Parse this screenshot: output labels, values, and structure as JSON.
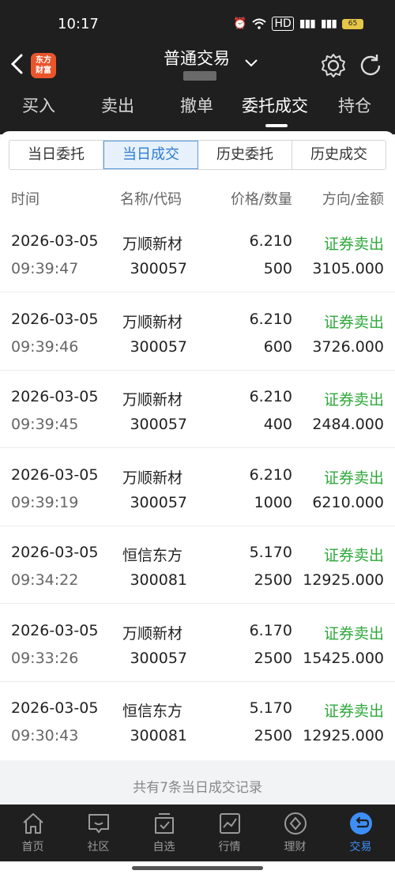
{
  "status_bar": {
    "time": "10:17",
    "battery": "65",
    "network": "4G"
  },
  "header": {
    "logo_text_line1": "东方",
    "logo_text_line2": "财富",
    "title": "普通交易"
  },
  "main_tabs": [
    {
      "label": "买入"
    },
    {
      "label": "卖出"
    },
    {
      "label": "撤单"
    },
    {
      "label": "委托成交",
      "active": true
    },
    {
      "label": "持仓"
    }
  ],
  "sub_tabs": [
    {
      "label": "当日委托"
    },
    {
      "label": "当日成交",
      "active": true
    },
    {
      "label": "历史委托"
    },
    {
      "label": "历史成交"
    }
  ],
  "columns": {
    "time": "时间",
    "name_code": "名称/代码",
    "price_qty": "价格/数量",
    "dir_amount": "方向/金额"
  },
  "rows": [
    {
      "date": "2026-03-05",
      "time": "09:39:47",
      "name": "万顺新材",
      "code": "300057",
      "price": "6.210",
      "qty": "500",
      "direction": "证券卖出",
      "amount": "3105.000"
    },
    {
      "date": "2026-03-05",
      "time": "09:39:46",
      "name": "万顺新材",
      "code": "300057",
      "price": "6.210",
      "qty": "600",
      "direction": "证券卖出",
      "amount": "3726.000"
    },
    {
      "date": "2026-03-05",
      "time": "09:39:45",
      "name": "万顺新材",
      "code": "300057",
      "price": "6.210",
      "qty": "400",
      "direction": "证券卖出",
      "amount": "2484.000"
    },
    {
      "date": "2026-03-05",
      "time": "09:39:19",
      "name": "万顺新材",
      "code": "300057",
      "price": "6.210",
      "qty": "1000",
      "direction": "证券卖出",
      "amount": "6210.000"
    },
    {
      "date": "2026-03-05",
      "time": "09:34:22",
      "name": "恒信东方",
      "code": "300081",
      "price": "5.170",
      "qty": "2500",
      "direction": "证券卖出",
      "amount": "12925.000"
    },
    {
      "date": "2026-03-05",
      "time": "09:33:26",
      "name": "万顺新材",
      "code": "300057",
      "price": "6.170",
      "qty": "2500",
      "direction": "证券卖出",
      "amount": "15425.000"
    },
    {
      "date": "2026-03-05",
      "time": "09:30:43",
      "name": "恒信东方",
      "code": "300081",
      "price": "5.170",
      "qty": "2500",
      "direction": "证券卖出",
      "amount": "12925.000"
    }
  ],
  "footer_note": "共有7条当日成交记录",
  "bottom_nav": [
    {
      "label": "首页",
      "icon": "home-icon"
    },
    {
      "label": "社区",
      "icon": "chat-icon"
    },
    {
      "label": "自选",
      "icon": "checkbox-icon"
    },
    {
      "label": "行情",
      "icon": "chart-icon"
    },
    {
      "label": "理财",
      "icon": "diamond-icon"
    },
    {
      "label": "交易",
      "icon": "exchange-icon",
      "active": true
    }
  ],
  "colors": {
    "sell_green": "#2ea83a",
    "active_blue": "#3d8ef5",
    "brand_orange": "#e9542b"
  }
}
